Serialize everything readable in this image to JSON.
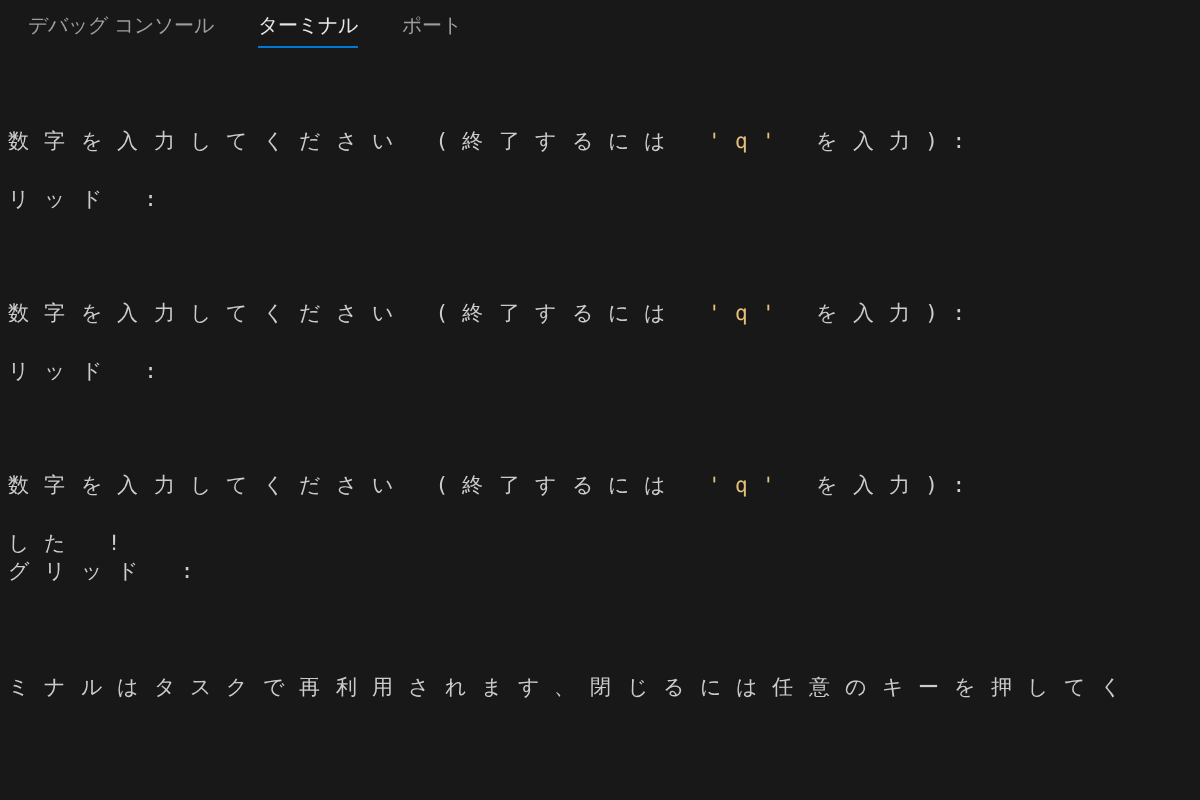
{
  "tabs": [
    {
      "label": "デバッグ コンソール",
      "selected": false
    },
    {
      "label": "ターミナル",
      "selected": true
    },
    {
      "label": "ポート",
      "selected": false
    }
  ],
  "terminal": {
    "lines": [
      {
        "kind": "prompt",
        "segments": [
          {
            "text": "数字を入力してください (終了するには ",
            "kind": "plain"
          },
          {
            "text": "'q'",
            "kind": "string"
          },
          {
            "text": " を入力):",
            "kind": "plain"
          }
        ]
      },
      {
        "kind": "result",
        "segments": [
          {
            "text": "リッド :",
            "kind": "plain"
          }
        ]
      },
      {
        "kind": "prompt",
        "segments": [
          {
            "text": "数字を入力してください (終了するには ",
            "kind": "plain"
          },
          {
            "text": "'q'",
            "kind": "string"
          },
          {
            "text": " を入力):",
            "kind": "plain"
          }
        ]
      },
      {
        "kind": "result",
        "segments": [
          {
            "text": "リッド :",
            "kind": "plain"
          }
        ]
      },
      {
        "kind": "prompt",
        "segments": [
          {
            "text": "数字を入力してください (終了するには ",
            "kind": "plain"
          },
          {
            "text": "'q'",
            "kind": "string"
          },
          {
            "text": " を入力):",
            "kind": "plain"
          }
        ]
      },
      {
        "kind": "result",
        "segments": [
          {
            "text": "した !",
            "kind": "plain"
          }
        ]
      },
      {
        "kind": "result",
        "segments": [
          {
            "text": "グリッド :",
            "kind": "plain"
          }
        ]
      },
      {
        "kind": "message",
        "segments": [
          {
            "text": "ミナルはタスクで再利用されます、閉じるには任意のキーを押してく",
            "kind": "plain"
          }
        ]
      }
    ]
  }
}
